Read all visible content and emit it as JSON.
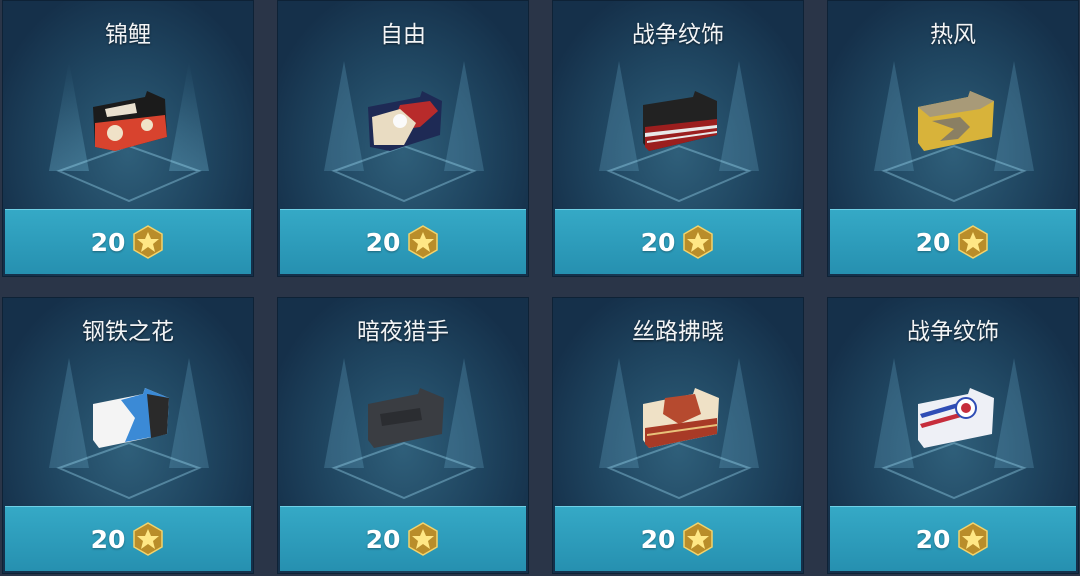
{
  "items": [
    {
      "name": "锦鲤",
      "price": "20",
      "skin": "koi"
    },
    {
      "name": "自由",
      "price": "20",
      "skin": "liberty"
    },
    {
      "name": "战争纹饰",
      "price": "20",
      "skin": "warpaint-red"
    },
    {
      "name": "热风",
      "price": "20",
      "skin": "hotwind"
    },
    {
      "name": "钢铁之花",
      "price": "20",
      "skin": "steelflower"
    },
    {
      "name": "暗夜猎手",
      "price": "20",
      "skin": "nighthunter"
    },
    {
      "name": "丝路拂晓",
      "price": "20",
      "skin": "silkroad"
    },
    {
      "name": "战争纹饰",
      "price": "20",
      "skin": "warpaint-blue"
    }
  ],
  "currency_icon": "gold-coin-icon"
}
